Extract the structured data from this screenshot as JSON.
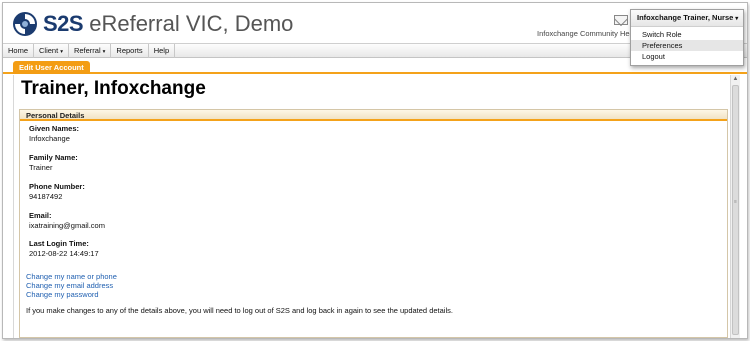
{
  "header": {
    "brand_short": "S2S",
    "brand_rest": "eReferral VIC, Demo",
    "org_text": "Infoxchange Community Health",
    "logo_icon": "s2s-swirl-logo",
    "mail_icon": "envelope-icon"
  },
  "user_menu": {
    "label": "Infoxchange Trainer, Nurse",
    "caret": "▾",
    "items": [
      "Switch Role",
      "Preferences",
      "Logout"
    ],
    "highlighted": "Preferences"
  },
  "nav": {
    "caret": "▾",
    "items": [
      {
        "label": "Home",
        "dropdown": false
      },
      {
        "label": "Client",
        "dropdown": true
      },
      {
        "label": "Referral",
        "dropdown": true
      },
      {
        "label": "Reports",
        "dropdown": false
      },
      {
        "label": "Help",
        "dropdown": false
      }
    ]
  },
  "tab": {
    "label": "Edit User Account"
  },
  "page": {
    "title": "Trainer, Infoxchange"
  },
  "panel": {
    "title": "Personal Details",
    "fields": [
      {
        "label": "Given Names:",
        "value": "Infoxchange"
      },
      {
        "label": "Family Name:",
        "value": "Trainer"
      },
      {
        "label": "Phone Number:",
        "value": "94187492"
      },
      {
        "label": "Email:",
        "value": "ixatraining@gmail.com"
      },
      {
        "label": "Last Login Time:",
        "value": "2012-08-22 14:49:17"
      }
    ],
    "links": [
      "Change my name or phone",
      "Change my email address",
      "Change my password"
    ],
    "note": "If you make changes to any of the details above, you will need to log out of S2S and log back in again to see the updated details."
  },
  "colors": {
    "accent_orange": "#f39d14",
    "link_blue": "#1f5fb0",
    "brand_navy": "#1b3b6f"
  }
}
